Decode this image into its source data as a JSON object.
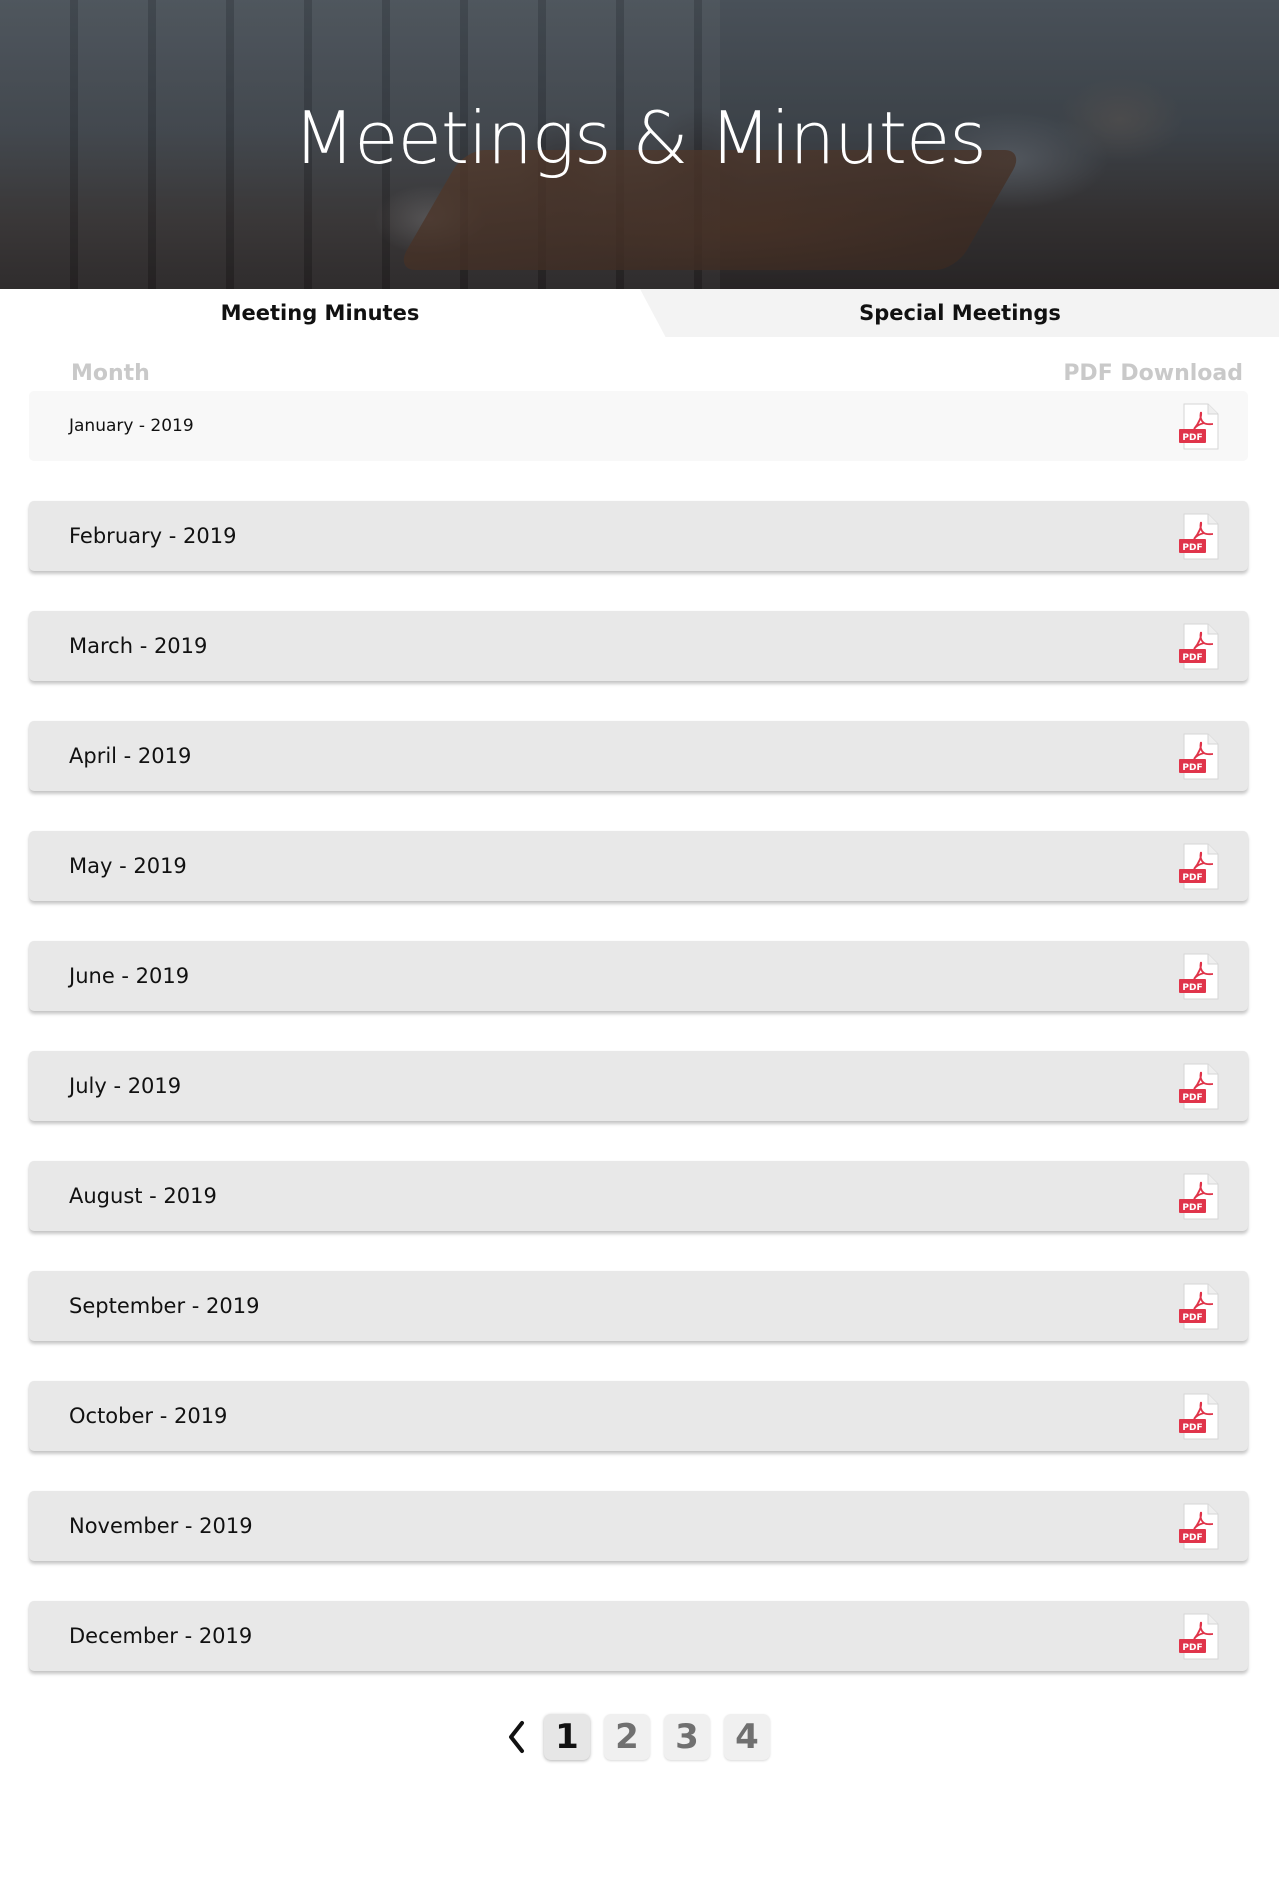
{
  "hero": {
    "title": "Meetings & Minutes"
  },
  "tabs": [
    {
      "label": "Meeting Minutes",
      "active": true
    },
    {
      "label": "Special Meetings",
      "active": false
    }
  ],
  "table": {
    "month_header": "Month",
    "pdf_header": "PDF Download",
    "rows": [
      {
        "label": "January - 2019"
      },
      {
        "label": "February - 2019"
      },
      {
        "label": "March - 2019"
      },
      {
        "label": "April - 2019"
      },
      {
        "label": "May - 2019"
      },
      {
        "label": "June - 2019"
      },
      {
        "label": "July - 2019"
      },
      {
        "label": "August - 2019"
      },
      {
        "label": "September - 2019"
      },
      {
        "label": "October - 2019"
      },
      {
        "label": "November - 2019"
      },
      {
        "label": "December - 2019"
      }
    ],
    "pdf_icon_text": "PDF"
  },
  "pagination": {
    "prev_icon": "chevron-left-icon",
    "pages": [
      "1",
      "2",
      "3",
      "4"
    ],
    "current": "1"
  },
  "colors": {
    "pdf_red": "#e0344a",
    "row_bg": "#e8e8e8",
    "header_gray": "#c9c9c9"
  }
}
